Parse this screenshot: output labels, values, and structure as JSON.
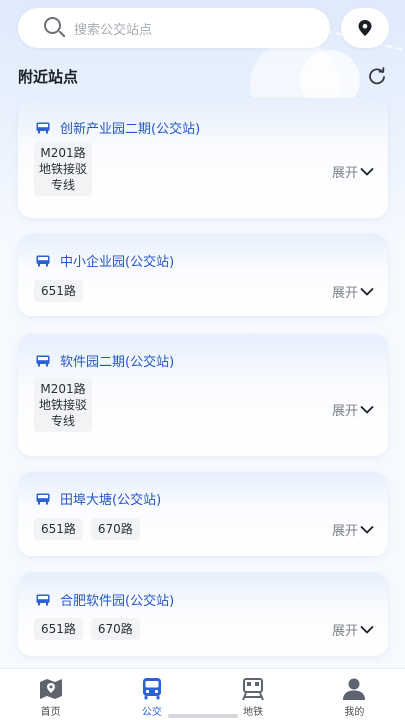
{
  "search": {
    "placeholder": "搜索公交站点"
  },
  "section": {
    "title": "附近站点"
  },
  "colors": {
    "accent": "#2a62d6",
    "stop_name": "#2457c5"
  },
  "stops": [
    {
      "name": "创新产业园二期(公交站)",
      "routes": [
        "M201路地铁接驳专线"
      ],
      "expand": "展开"
    },
    {
      "name": "中小企业园(公交站)",
      "routes": [
        "651路"
      ],
      "expand": "展开"
    },
    {
      "name": "软件园二期(公交站)",
      "routes": [
        "M201路地铁接驳专线"
      ],
      "expand": "展开"
    },
    {
      "name": "田埠大塘(公交站)",
      "routes": [
        "651路",
        "670路"
      ],
      "expand": "展开"
    },
    {
      "name": "合肥软件园(公交站)",
      "routes": [
        "651路",
        "670路"
      ],
      "expand": "展开"
    }
  ],
  "tabs": [
    {
      "label": "首页",
      "icon": "map-icon",
      "active": false
    },
    {
      "label": "公交",
      "icon": "bus-icon",
      "active": true
    },
    {
      "label": "地铁",
      "icon": "metro-icon",
      "active": false
    },
    {
      "label": "我的",
      "icon": "user-icon",
      "active": false
    }
  ]
}
